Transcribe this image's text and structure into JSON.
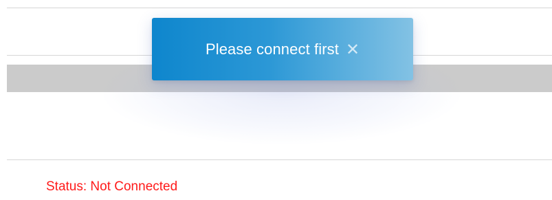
{
  "toast": {
    "message": "Please connect first",
    "close_icon": "close-icon",
    "close_glyph": "✕",
    "gradient_start": "#0e86cd",
    "gradient_end": "#83c2e4"
  },
  "status": {
    "text": "Status: Not Connected",
    "color": "#ff1a1a"
  },
  "colors": {
    "divider": "#d6d6d6",
    "gray_bar": "#cbcbcb",
    "background": "#ffffff"
  }
}
